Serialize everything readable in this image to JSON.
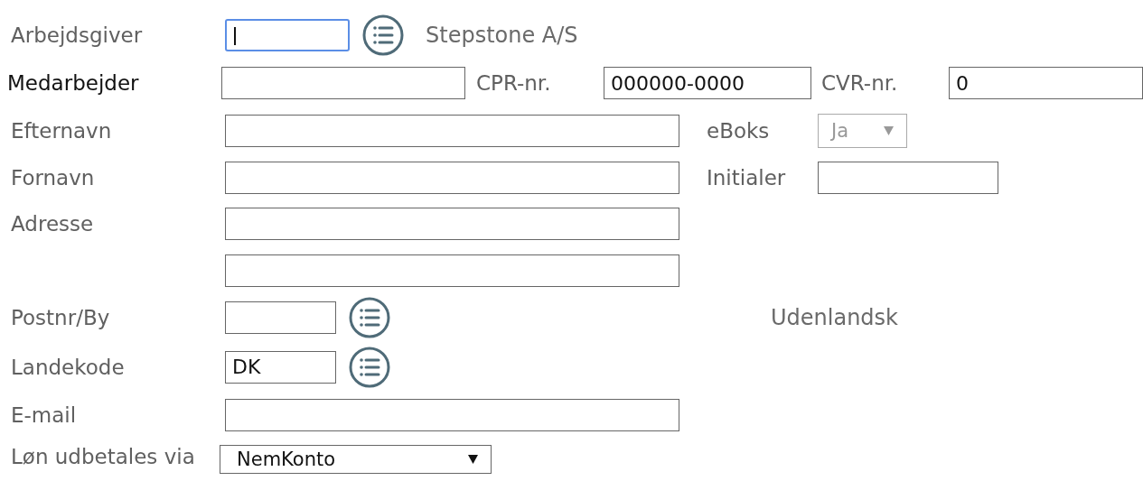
{
  "rows": [
    {
      "kind": "employer",
      "label": "Arbejdsgiver",
      "input": {
        "focused": true
      },
      "note": "Stepstone A/S"
    },
    {
      "kind": "person",
      "label": "Medarbejder",
      "input": {
        "focused": false
      },
      "cpr_label": "CPR-nr.",
      "cpr": {
        "value": "000000-0000",
        "focused": false
      },
      "cvr_label": "CVR-nr.",
      "cvr": {
        "value": "0",
        "focused": false
      }
    },
    {
      "kind": "wide",
      "label": "Efternavn",
      "input": {
        "focused": false
      },
      "side": {
        "kind": "select",
        "label": "eBoks",
        "value": "Ja",
        "disabled": true
      }
    },
    {
      "kind": "wide",
      "label": "Fornavn",
      "input": {
        "focused": false
      },
      "side": {
        "kind": "input",
        "label": "Initialer",
        "input": {
          "focused": false
        }
      }
    },
    {
      "kind": "wide",
      "label": "Adresse",
      "input": {
        "focused": false
      }
    },
    {
      "kind": "wide",
      "input": {
        "focused": false
      }
    },
    {
      "kind": "short",
      "label": "Postnr/By",
      "input": {
        "focused": false
      },
      "note": "Udenlandsk"
    },
    {
      "kind": "short",
      "label": "Landekode",
      "input": {
        "value": "DK",
        "focused": false
      }
    },
    {
      "kind": "wide",
      "label": "E-mail",
      "input": {
        "focused": false
      }
    },
    {
      "kind": "payment",
      "label": "Løn udbetales via",
      "select": {
        "value": "NemKonto",
        "disabled": false
      }
    }
  ]
}
